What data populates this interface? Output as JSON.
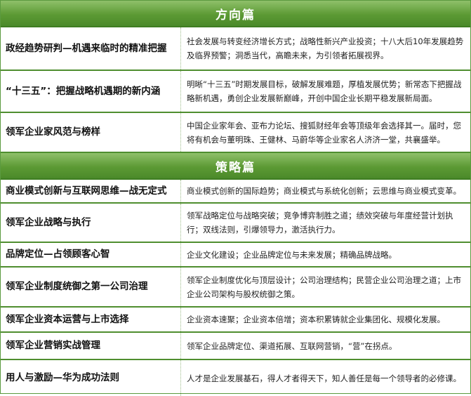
{
  "sections": [
    {
      "title": "方向篇",
      "rows": [
        {
          "topic": "政经趋势研判—机遇来临时的精准把握",
          "desc": "社会发展与转变经济增长方式；战略性新兴产业投资；十八大后10年发展趋势及临界预警；洞悉当代，高瞻未来，为引领者拓展视界。"
        },
        {
          "topic": "“十三五”：把握战略机遇期的新内涵",
          "desc": "明晰“十三五”时期发展目标，破解发展难题，厚植发展优势；新常态下把握战略新机遇，勇创企业发展新巅峰，开创中国企业长期平稳发展新局面。"
        },
        {
          "topic": "领军企业家风范与榜样",
          "desc": "中国企业家年会、亚布力论坛、搜狐财经年会等顶级年会选择其一。届时，您将有机会与董明珠、王健林、马蔚华等企业家名人济济一堂，共襄盛举。"
        }
      ]
    },
    {
      "title": "策略篇",
      "rows": [
        {
          "topic": "商业模式创新与互联网思维—战无定式",
          "desc": "商业模式创新的国际趋势；商业模式与系统化创新；云思维与商业模式变革。"
        },
        {
          "topic": "领军企业战略与执行",
          "desc": "领军战略定位与战略突破；竞争博弈制胜之道；绩效突破与年度经营计划执行；双线法则，引爆领导力，激活执行力。"
        },
        {
          "topic": "品牌定位—占领顾客心智",
          "desc": "企业文化建设；企业品牌定位与未来发展；精确品牌战略。"
        },
        {
          "topic": "领军企业制度统御之第一公司治理",
          "desc": "领军企业制度优化与顶层设计；公司治理结构；民营企业公司治理之道；上市企业公司架构与股权统御之策。"
        },
        {
          "topic": "领军企业资本运营与上市选择",
          "desc": "企业资本速聚；企业资本倍增；资本积累铸就企业集团化、规模化发展。"
        },
        {
          "topic": "领军企业营销实战管理",
          "desc": "领军企业品牌定位、渠道拓展、互联网营销，“营”在拐点。"
        },
        {
          "topic": "用人与激励—华为成功法则",
          "desc": "人才是企业发展基石，得人才者得天下，知人善任是每一个领导者的必修课。"
        }
      ]
    }
  ]
}
